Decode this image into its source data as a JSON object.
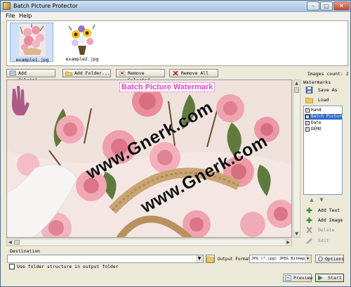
{
  "window": {
    "title": "Batch Picture Protector",
    "controls": {
      "minimize": "–",
      "maximize": "□",
      "close": "✕"
    }
  },
  "menu": [
    "File",
    "Help"
  ],
  "thumbnails": [
    {
      "label": "example1.jpg",
      "selected": true
    },
    {
      "label": "example2.jpg",
      "selected": false
    }
  ],
  "images_count": "Images count: 2",
  "toolbar": {
    "add_files": "Add File(s)...",
    "add_folder": "Add Folder...",
    "remove_selected": "Remove Selected",
    "remove_all": "Remove All"
  },
  "preview": {
    "watermark_title": "Batch Picture Watermark",
    "watermark_text_1": "www.Gnerk.com",
    "watermark_text_2": "www.Gnerk.com"
  },
  "watermarks_panel": {
    "title": "Watermarks",
    "save_as": "Save As",
    "load": "Load",
    "items": [
      {
        "label": "Hand",
        "checked": true,
        "selected": false
      },
      {
        "label": "Batch Picture",
        "checked": true,
        "selected": true
      },
      {
        "label": "Date",
        "checked": true,
        "selected": false
      },
      {
        "label": "DEMO",
        "checked": true,
        "selected": false
      }
    ],
    "add_text": "Add Text",
    "add_image": "Add Image",
    "delete": "Delete",
    "edit": "Edit"
  },
  "output": {
    "destination_label": "Destination",
    "destination_value": "",
    "format_label": "Output Format",
    "format_value": "JPG (*.jpg) JPEG Bitmap",
    "options": "Options",
    "use_structure": "Use folder structure in output folder",
    "use_structure_checked": false,
    "preview": "Preview",
    "start": "Start"
  },
  "colors": {
    "accent_selection": "#316ac5",
    "watermark_pink": "#e24cc8",
    "window_bg": "#ece9d8"
  },
  "icons": [
    "app-icon",
    "add-file-icon",
    "add-folder-icon",
    "remove-icon",
    "remove-all-icon",
    "save-icon",
    "load-folder-icon",
    "add-text-icon",
    "add-image-icon",
    "delete-icon",
    "edit-icon",
    "options-icon",
    "preview-icon",
    "start-icon"
  ]
}
